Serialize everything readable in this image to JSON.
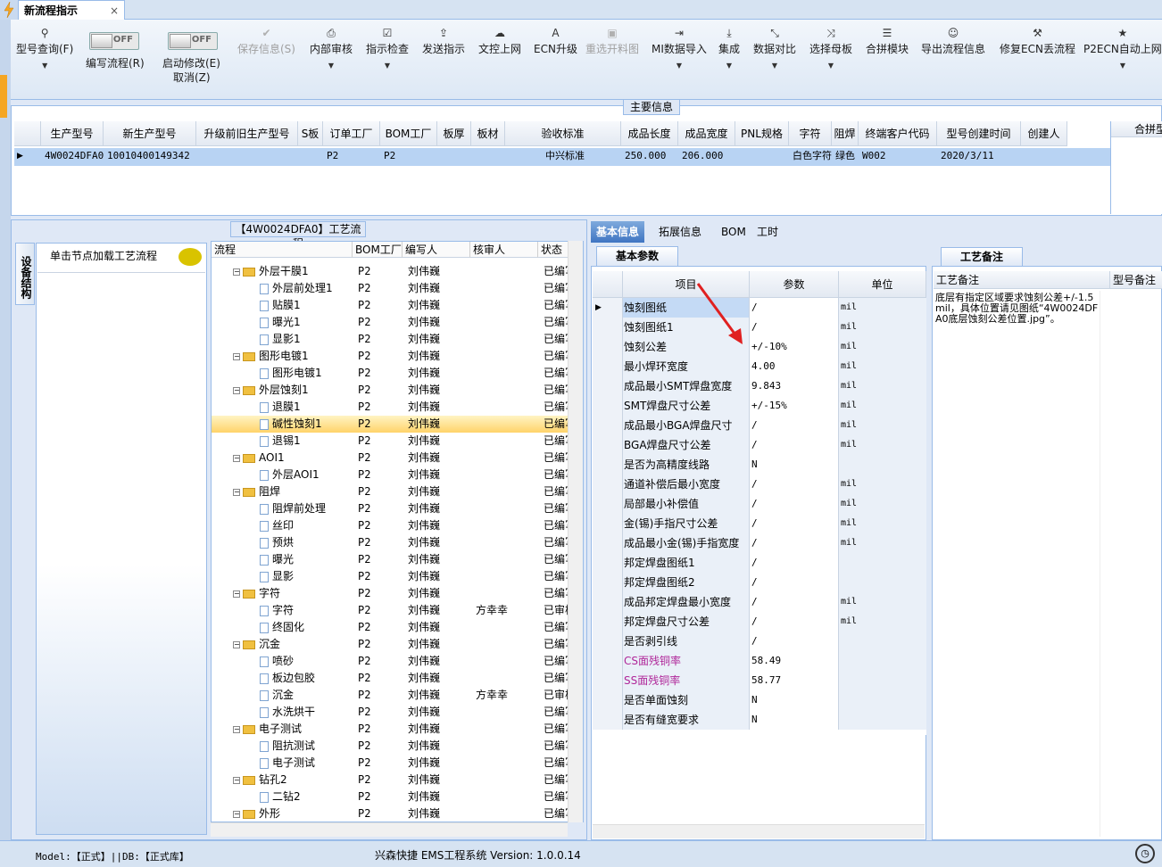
{
  "tab": {
    "title": "新流程指示",
    "close": "×"
  },
  "toolbar": {
    "search": {
      "icon": "search-icon",
      "label": "型号查询(F)"
    },
    "edit_toggle": {
      "state": "OFF",
      "label": "编写流程(R)"
    },
    "modify_toggle": {
      "state": "OFF",
      "label": "启动修改(E)",
      "label2": "取消(Z)"
    },
    "buttons": [
      {
        "label": "保存信息(S)",
        "icon": "check-icon",
        "disabled": true
      },
      {
        "label": "内部审核",
        "icon": "print-icon"
      },
      {
        "label": "指示检查",
        "icon": "checkbox-icon"
      },
      {
        "label": "发送指示",
        "icon": "upload-icon"
      },
      {
        "label": "文控上网",
        "icon": "cloud-upload-icon"
      },
      {
        "label": "ECN升级",
        "icon": "font-icon"
      },
      {
        "label": "重选开料图",
        "icon": "image-icon",
        "disabled": true
      },
      {
        "label": "MI数据导入",
        "icon": "sign-in-icon"
      },
      {
        "label": "集成",
        "icon": "download-icon"
      },
      {
        "label": "数据对比",
        "icon": "compress-icon"
      },
      {
        "label": "选择母板",
        "icon": "random-icon"
      },
      {
        "label": "合拼模块",
        "icon": "list-icon"
      },
      {
        "label": "导出流程信息",
        "icon": "smile-icon"
      },
      {
        "label": "修复ECN丢流程",
        "icon": "wrench-icon"
      },
      {
        "label": "P2ECN自动上网",
        "icon": "star-icon"
      }
    ]
  },
  "main_info": {
    "title": "主要信息",
    "columns": [
      "生产型号",
      "新生产型号",
      "升级前旧生产型号",
      "S板",
      "订单工厂",
      "BOM工厂",
      "板厚",
      "板材",
      "验收标准",
      "成品长度",
      "成品宽度",
      "PNL规格",
      "字符",
      "阻焊",
      "终端客户代码",
      "型号创建时间",
      "创建人"
    ],
    "row": [
      "4W0024DFA0",
      "10010400149342",
      "",
      "",
      "P2",
      "P2",
      "",
      "",
      "中兴标准",
      "250.000",
      "206.000",
      "",
      "白色字符",
      "绿色",
      "W002",
      "2020/3/11",
      ""
    ],
    "side_header": "合拼型"
  },
  "process": {
    "title": "【4W0024DFA0】工艺流程",
    "side_tab": "设备结构",
    "node_hint": "单击节点加载工艺流程",
    "columns": [
      "流程",
      "BOM工厂",
      "编写人",
      "核审人",
      "状态"
    ],
    "rows": [
      {
        "level": 1,
        "name": "外层干膜1",
        "bom": "P2",
        "writer": "刘伟巍",
        "reviewer": "",
        "status": "已编写"
      },
      {
        "level": 2,
        "name": "外层前处理1",
        "bom": "P2",
        "writer": "刘伟巍",
        "reviewer": "",
        "status": "已编写"
      },
      {
        "level": 2,
        "name": "贴膜1",
        "bom": "P2",
        "writer": "刘伟巍",
        "reviewer": "",
        "status": "已编写"
      },
      {
        "level": 2,
        "name": "曝光1",
        "bom": "P2",
        "writer": "刘伟巍",
        "reviewer": "",
        "status": "已编写"
      },
      {
        "level": 2,
        "name": "显影1",
        "bom": "P2",
        "writer": "刘伟巍",
        "reviewer": "",
        "status": "已编写"
      },
      {
        "level": 1,
        "name": "图形电镀1",
        "bom": "P2",
        "writer": "刘伟巍",
        "reviewer": "",
        "status": "已编写"
      },
      {
        "level": 2,
        "name": "图形电镀1",
        "bom": "P2",
        "writer": "刘伟巍",
        "reviewer": "",
        "status": "已编写"
      },
      {
        "level": 1,
        "name": "外层蚀刻1",
        "bom": "P2",
        "writer": "刘伟巍",
        "reviewer": "",
        "status": "已编写"
      },
      {
        "level": 2,
        "name": "退膜1",
        "bom": "P2",
        "writer": "刘伟巍",
        "reviewer": "",
        "status": "已编写"
      },
      {
        "level": 2,
        "name": "碱性蚀刻1",
        "bom": "P2",
        "writer": "刘伟巍",
        "reviewer": "",
        "status": "已编写",
        "selected": true
      },
      {
        "level": 2,
        "name": "退锡1",
        "bom": "P2",
        "writer": "刘伟巍",
        "reviewer": "",
        "status": "已编写"
      },
      {
        "level": 1,
        "name": "AOI1",
        "bom": "P2",
        "writer": "刘伟巍",
        "reviewer": "",
        "status": "已编写"
      },
      {
        "level": 2,
        "name": "外层AOI1",
        "bom": "P2",
        "writer": "刘伟巍",
        "reviewer": "",
        "status": "已编写"
      },
      {
        "level": 1,
        "name": "阻焊",
        "bom": "P2",
        "writer": "刘伟巍",
        "reviewer": "",
        "status": "已编写"
      },
      {
        "level": 2,
        "name": "阻焊前处理",
        "bom": "P2",
        "writer": "刘伟巍",
        "reviewer": "",
        "status": "已编写"
      },
      {
        "level": 2,
        "name": "丝印",
        "bom": "P2",
        "writer": "刘伟巍",
        "reviewer": "",
        "status": "已编写"
      },
      {
        "level": 2,
        "name": "预烘",
        "bom": "P2",
        "writer": "刘伟巍",
        "reviewer": "",
        "status": "已编写"
      },
      {
        "level": 2,
        "name": "曝光",
        "bom": "P2",
        "writer": "刘伟巍",
        "reviewer": "",
        "status": "已编写"
      },
      {
        "level": 2,
        "name": "显影",
        "bom": "P2",
        "writer": "刘伟巍",
        "reviewer": "",
        "status": "已编写"
      },
      {
        "level": 1,
        "name": "字符",
        "bom": "P2",
        "writer": "刘伟巍",
        "reviewer": "",
        "status": "已编写"
      },
      {
        "level": 2,
        "name": "字符",
        "bom": "P2",
        "writer": "刘伟巍",
        "reviewer": "方幸幸",
        "status": "已审核"
      },
      {
        "level": 2,
        "name": "终固化",
        "bom": "P2",
        "writer": "刘伟巍",
        "reviewer": "",
        "status": "已编写"
      },
      {
        "level": 1,
        "name": "沉金",
        "bom": "P2",
        "writer": "刘伟巍",
        "reviewer": "",
        "status": "已编写"
      },
      {
        "level": 2,
        "name": "喷砂",
        "bom": "P2",
        "writer": "刘伟巍",
        "reviewer": "",
        "status": "已编写"
      },
      {
        "level": 2,
        "name": "板边包胶",
        "bom": "P2",
        "writer": "刘伟巍",
        "reviewer": "",
        "status": "已编写"
      },
      {
        "level": 2,
        "name": "沉金",
        "bom": "P2",
        "writer": "刘伟巍",
        "reviewer": "方幸幸",
        "status": "已审核"
      },
      {
        "level": 2,
        "name": "水洗烘干",
        "bom": "P2",
        "writer": "刘伟巍",
        "reviewer": "",
        "status": "已编写"
      },
      {
        "level": 1,
        "name": "电子测试",
        "bom": "P2",
        "writer": "刘伟巍",
        "reviewer": "",
        "status": "已编写"
      },
      {
        "level": 2,
        "name": "阻抗测试",
        "bom": "P2",
        "writer": "刘伟巍",
        "reviewer": "",
        "status": "已编写"
      },
      {
        "level": 2,
        "name": "电子测试",
        "bom": "P2",
        "writer": "刘伟巍",
        "reviewer": "",
        "status": "已编写"
      },
      {
        "level": 1,
        "name": "钻孔2",
        "bom": "P2",
        "writer": "刘伟巍",
        "reviewer": "",
        "status": "已编写"
      },
      {
        "level": 2,
        "name": "二钻2",
        "bom": "P2",
        "writer": "刘伟巍",
        "reviewer": "",
        "status": "已编写"
      },
      {
        "level": 1,
        "name": "外形",
        "bom": "P2",
        "writer": "刘伟巍",
        "reviewer": "",
        "status": "已编写"
      }
    ]
  },
  "right_tabs": [
    "基本信息",
    "拓展信息",
    "BOM",
    "工时"
  ],
  "params": {
    "tab": "基本参数",
    "columns": [
      "项目",
      "参数",
      "单位"
    ],
    "rows": [
      {
        "item": "蚀刻图纸",
        "value": "/",
        "unit": "mil",
        "selected": true
      },
      {
        "item": "蚀刻图纸1",
        "value": "/",
        "unit": "mil"
      },
      {
        "item": "蚀刻公差",
        "value": "+/-10%",
        "unit": "mil"
      },
      {
        "item": "最小焊环宽度",
        "value": "4.00",
        "unit": "mil"
      },
      {
        "item": "成品最小SMT焊盘宽度",
        "value": "9.843",
        "unit": "mil"
      },
      {
        "item": "SMT焊盘尺寸公差",
        "value": "+/-15%",
        "unit": "mil"
      },
      {
        "item": "成品最小BGA焊盘尺寸",
        "value": "/",
        "unit": "mil"
      },
      {
        "item": "BGA焊盘尺寸公差",
        "value": "/",
        "unit": "mil"
      },
      {
        "item": "是否为高精度线路",
        "value": "N",
        "unit": ""
      },
      {
        "item": "通道补偿后最小宽度",
        "value": "/",
        "unit": "mil"
      },
      {
        "item": "局部最小补偿值",
        "value": "/",
        "unit": "mil"
      },
      {
        "item": "金(锡)手指尺寸公差",
        "value": "/",
        "unit": "mil"
      },
      {
        "item": "成品最小金(锡)手指宽度",
        "value": "/",
        "unit": "mil"
      },
      {
        "item": "邦定焊盘图纸1",
        "value": "/",
        "unit": ""
      },
      {
        "item": "邦定焊盘图纸2",
        "value": "/",
        "unit": ""
      },
      {
        "item": "成品邦定焊盘最小宽度",
        "value": "/",
        "unit": "mil"
      },
      {
        "item": "邦定焊盘尺寸公差",
        "value": "/",
        "unit": "mil"
      },
      {
        "item": "是否剥引线",
        "value": "/",
        "unit": ""
      },
      {
        "item": "CS面残铜率",
        "value": "58.49",
        "unit": "",
        "pink": true
      },
      {
        "item": "SS面残铜率",
        "value": "58.77",
        "unit": "",
        "pink": true
      },
      {
        "item": "是否单面蚀刻",
        "value": "N",
        "unit": ""
      },
      {
        "item": "是否有缝宽要求",
        "value": "N",
        "unit": ""
      }
    ]
  },
  "remarks": {
    "tab": "工艺备注",
    "col1": "工艺备注",
    "col2": "型号备注",
    "text": "底层有指定区域要求蚀刻公差+/-1.5mil，具体位置请见图纸“4W0024DFA0底层蚀刻公差位置.jpg”。"
  },
  "status": {
    "left": "Model:【正式】||DB:【正式库】",
    "center": "兴森快捷 EMS工程系统 Version: 1.0.0.14"
  },
  "colors": {
    "accent": "#3f75c2",
    "selected_row": "#b8d3f3",
    "highlight": "#ffd36a",
    "annotation_arrow": "#e02020"
  }
}
